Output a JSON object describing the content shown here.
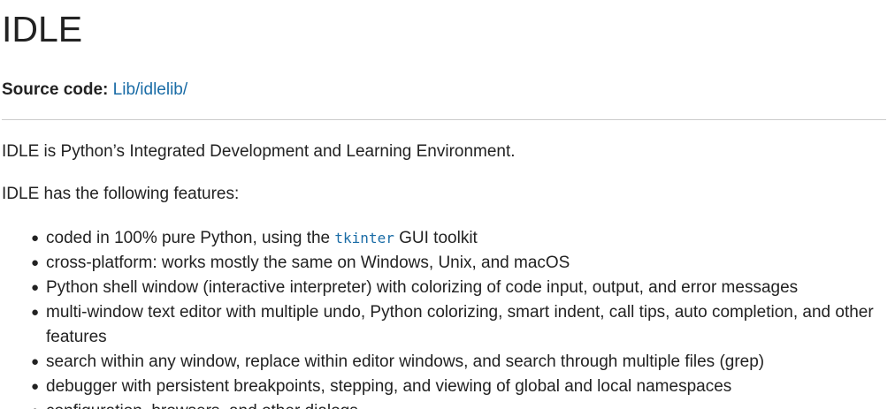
{
  "page": {
    "title": "IDLE",
    "source_label": "Source code:",
    "source_link": "Lib/idlelib/",
    "intro": "IDLE is Python’s Integrated Development and Learning Environment.",
    "features_intro": "IDLE has the following features:"
  },
  "features": {
    "item0": {
      "before": "coded in 100% pure Python, using the ",
      "code": "tkinter",
      "after": " GUI toolkit"
    },
    "item1": "cross-platform: works mostly the same on Windows, Unix, and macOS",
    "item2": "Python shell window (interactive interpreter) with colorizing of code input, output, and error messages",
    "item3": "multi-window text editor with multiple undo, Python colorizing, smart indent, call tips, auto completion, and other features",
    "item4": "search within any window, replace within editor windows, and search through multiple files (grep)",
    "item5": "debugger with persistent breakpoints, stepping, and viewing of global and local namespaces",
    "item6": "configuration, browsers, and other dialogs"
  },
  "colors": {
    "link": "#1a6ca6",
    "text": "#222222",
    "rule": "#cccccc"
  }
}
